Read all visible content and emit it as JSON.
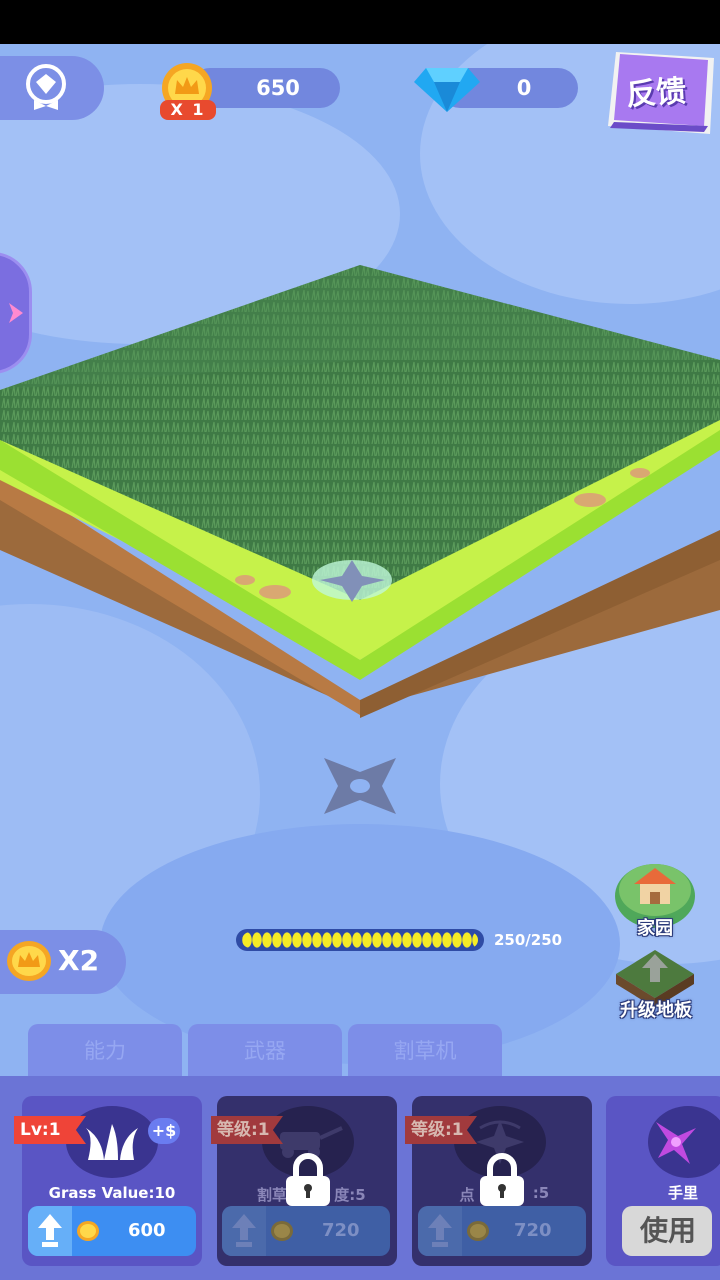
{
  "header": {
    "coins": "650",
    "coin_multiplier": "X 1",
    "gems": "0",
    "feedback_label": "反馈"
  },
  "game": {
    "progress_text": "250/250",
    "progress_fraction": 1.0,
    "boost_label": "X2"
  },
  "side_buttons": {
    "home_label": "家园",
    "upgrade_land_label": "升级地板"
  },
  "tabs": [
    {
      "label": "能力"
    },
    {
      "label": "武器"
    },
    {
      "label": "割草机"
    }
  ],
  "cards": {
    "grass": {
      "level": "Lv:1",
      "bonus": "+$",
      "caption": "Grass Value:10",
      "price": "600"
    },
    "mower_speed": {
      "level": "等级:1",
      "caption_left": "割草",
      "caption_right": "度:5",
      "price": "720"
    },
    "points": {
      "level": "等级:1",
      "caption_left": "点",
      "caption_right": ":5",
      "price": "720"
    },
    "partial": {
      "caption": "手里",
      "button": "使用"
    }
  },
  "colors": {
    "sky": "#8fb3f2",
    "panel": "#6b74d6",
    "accent_red": "#ef4438",
    "button_blue": "#3d8ef2",
    "progress_yellow": "#f6ec25"
  },
  "icons": [
    "achievement-icon",
    "crown-coin-icon",
    "diamond-icon",
    "feedback-book-icon",
    "shuriken-icon",
    "home-icon",
    "upgrade-arrow-icon",
    "grass-icon",
    "lock-icon",
    "upgrade-arrow-icon",
    "coin-icon",
    "lawnmower-icon",
    "shuriken-spin-icon",
    "purple-shuriken-icon"
  ]
}
